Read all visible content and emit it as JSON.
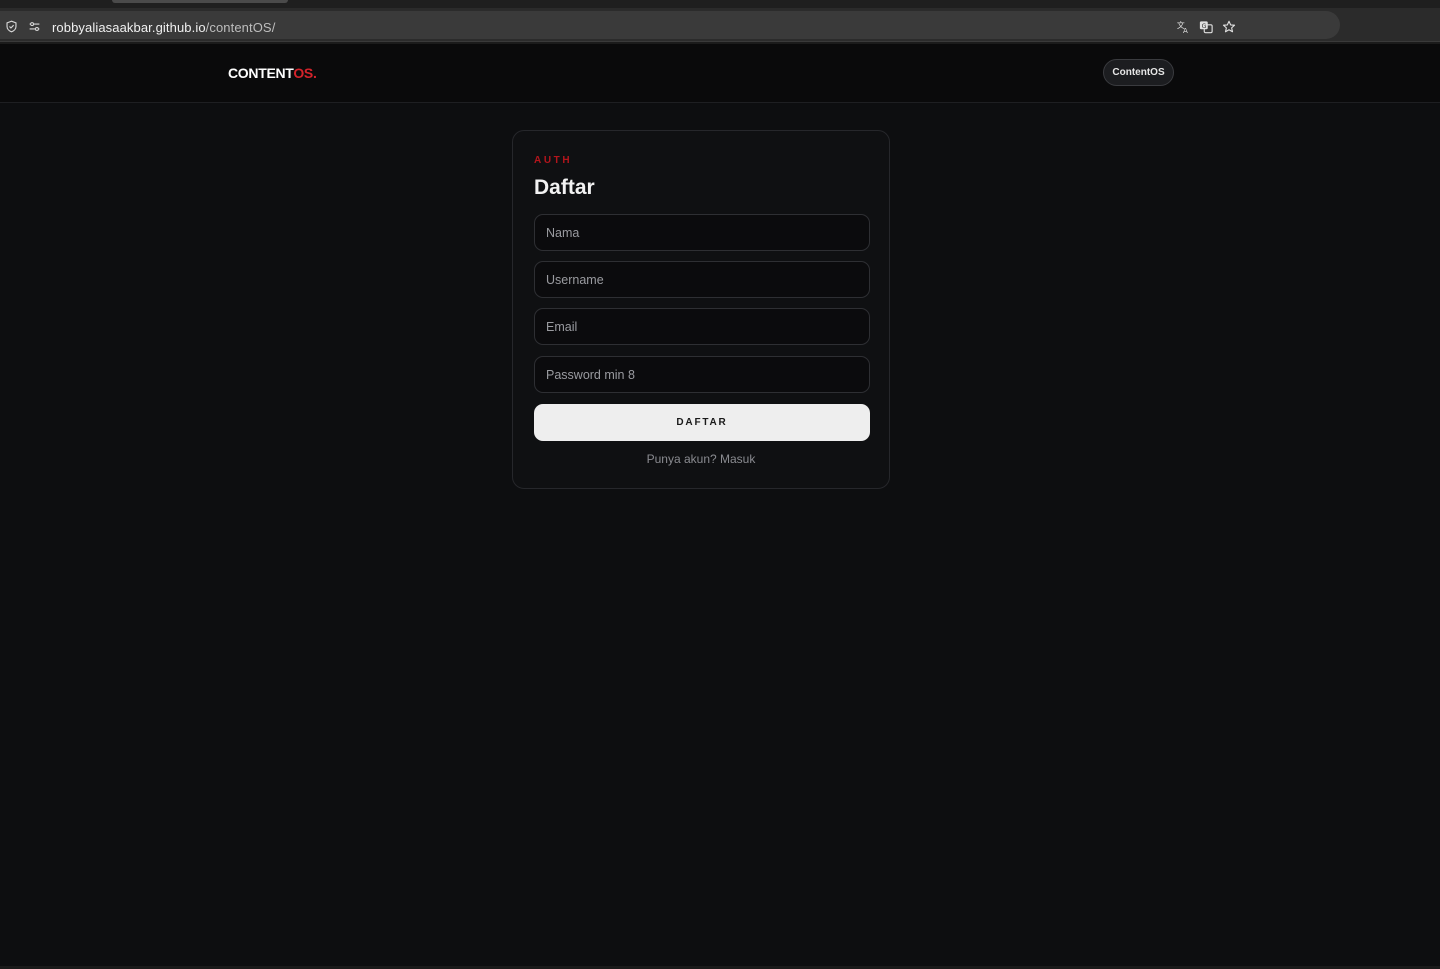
{
  "browser": {
    "url_host": "robbyaliasaakbar.github.io",
    "url_path": "/contentOS/"
  },
  "header": {
    "brand_main": "CONTENT",
    "brand_accent": "OS.",
    "badge": "ContentOS"
  },
  "card": {
    "eyebrow": "AUTH",
    "title": "Daftar",
    "fields": {
      "name_placeholder": "Nama",
      "username_placeholder": "Username",
      "email_placeholder": "Email",
      "password_placeholder": "Password min 8"
    },
    "submit_label": "DAFTAR",
    "switch_text": "Punya akun? Masuk"
  },
  "colors": {
    "accent": "#d4232b",
    "background": "#0d0e10",
    "button": "#eeeeee"
  },
  "icons": {
    "security": "shield-check-icon",
    "site_settings": "tune-icon",
    "translate": "translate-icon",
    "page_translate": "page-translate-icon",
    "bookmark": "star-icon"
  }
}
